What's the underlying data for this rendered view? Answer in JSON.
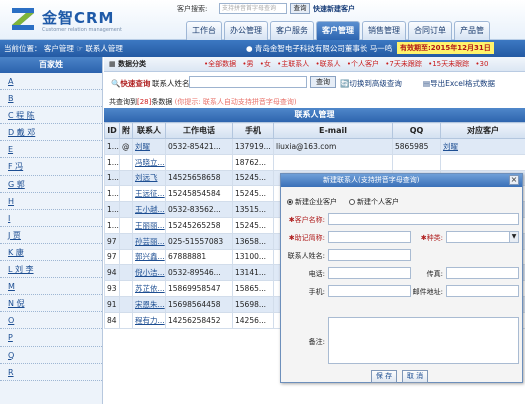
{
  "header": {
    "brand": "金智CRM",
    "brand_sub": "Customer relation management",
    "search_label": "客户搜索:",
    "search_placeholder": "支持拼音首字母查询",
    "search_button": "查询",
    "quick_new": "快速新建客户",
    "tabs": [
      {
        "label": "工作台",
        "active": false
      },
      {
        "label": "办公管理",
        "active": false
      },
      {
        "label": "客户服务",
        "active": false
      },
      {
        "label": "客户管理",
        "active": true
      },
      {
        "label": "销售管理",
        "active": false
      },
      {
        "label": "合同订单",
        "active": false
      },
      {
        "label": "产品管",
        "active": false
      }
    ]
  },
  "infobar": {
    "breadcrumb": "当前位置： 客户管理 ☞ 联系人管理",
    "company": "● 青岛金智电子科技有限公司董事长  马一鸣",
    "notice": "有效期至:2015年12月31日"
  },
  "sidebar": {
    "header": "百家姓",
    "items": [
      "A",
      "B",
      "C 程 陈",
      "D 戴 邓",
      "E",
      "F 冯",
      "G 郭",
      "H",
      "I",
      "J 贾",
      "K 康",
      "L 刘 李",
      "M",
      "N 倪",
      "O",
      "P",
      "Q",
      "R"
    ]
  },
  "filters": {
    "title": "数据分类",
    "links": [
      "•全部数据",
      "•男",
      "•女",
      "•主联系人",
      "•联系人",
      "•个人客户",
      "•7天未跟踪",
      "•15天未跟踪",
      "•30"
    ]
  },
  "toolbar": {
    "quick_search": "快速查询",
    "name_label": "联系人姓名",
    "search_button": "查询",
    "advanced": "切换到高级查询",
    "export": "导出Excel格式数据"
  },
  "summary": {
    "prefix": "共查询到",
    "count": "[28]",
    "suffix": "条数据",
    "hint": "(你提示: 联系人自动支持拼音字母查询)"
  },
  "table": {
    "caption": "联系人管理",
    "columns": [
      "ID",
      "附",
      "联系人",
      "工作电话",
      "手机",
      "E-mail",
      "QQ",
      "对应客户"
    ],
    "rows": [
      [
        "1...",
        "@",
        "刘曜",
        "0532-85421...",
        "137919...",
        "liuxia@163.com",
        "5865985",
        "刘曜"
      ],
      [
        "1...",
        "",
        "冯晓立...",
        "",
        "18762...",
        "",
        "",
        ""
      ],
      [
        "1...",
        "",
        "刘远飞",
        "14525658658",
        "15245...",
        "",
        "",
        ""
      ],
      [
        "1...",
        "",
        "王远征...",
        "15245854584",
        "15245...",
        "",
        "",
        ""
      ],
      [
        "1...",
        "",
        "王小越...",
        "0532-83562...",
        "13515...",
        "",
        "",
        ""
      ],
      [
        "1...",
        "",
        "王丽丽...",
        "15245265258",
        "15245...",
        "",
        "",
        ""
      ],
      [
        "97",
        "",
        "孙芸丽...",
        "025-51557083",
        "13658...",
        "",
        "",
        ""
      ],
      [
        "97",
        "",
        "郭兴鑫...",
        "67888881",
        "13100...",
        "",
        "",
        ""
      ],
      [
        "94",
        "",
        "倪小洁...",
        "0532-89546...",
        "13141...",
        "",
        "",
        ""
      ],
      [
        "93",
        "",
        "苏芷依...",
        "15869958547",
        "15865...",
        "",
        "",
        ""
      ],
      [
        "91",
        "",
        "宋恩朱...",
        "15698564458",
        "15698...",
        "",
        "",
        ""
      ],
      [
        "84",
        "",
        "程有力...",
        "14256258452",
        "14256...",
        "",
        "",
        ""
      ]
    ]
  },
  "dialog": {
    "title": "新建联系人(支持拼音字母查询)",
    "close": "×",
    "radio_company": "新建企业客户",
    "radio_person": "新建个人客户",
    "customer_name": "客户名称:",
    "short_name": "助记简称:",
    "kind": "种类:",
    "contact_name": "联系人姓名:",
    "phone": "电话:",
    "fax": "传真:",
    "mobile": "手机:",
    "email": "邮件地址:",
    "remark": "备注:",
    "save": "保 存",
    "cancel": "取 消"
  },
  "colors": {
    "accent_blue": "#2c64b0",
    "link_blue": "#1d4e92",
    "highlight_red": "#c81d1d",
    "notice_yellow": "#fff36b"
  }
}
